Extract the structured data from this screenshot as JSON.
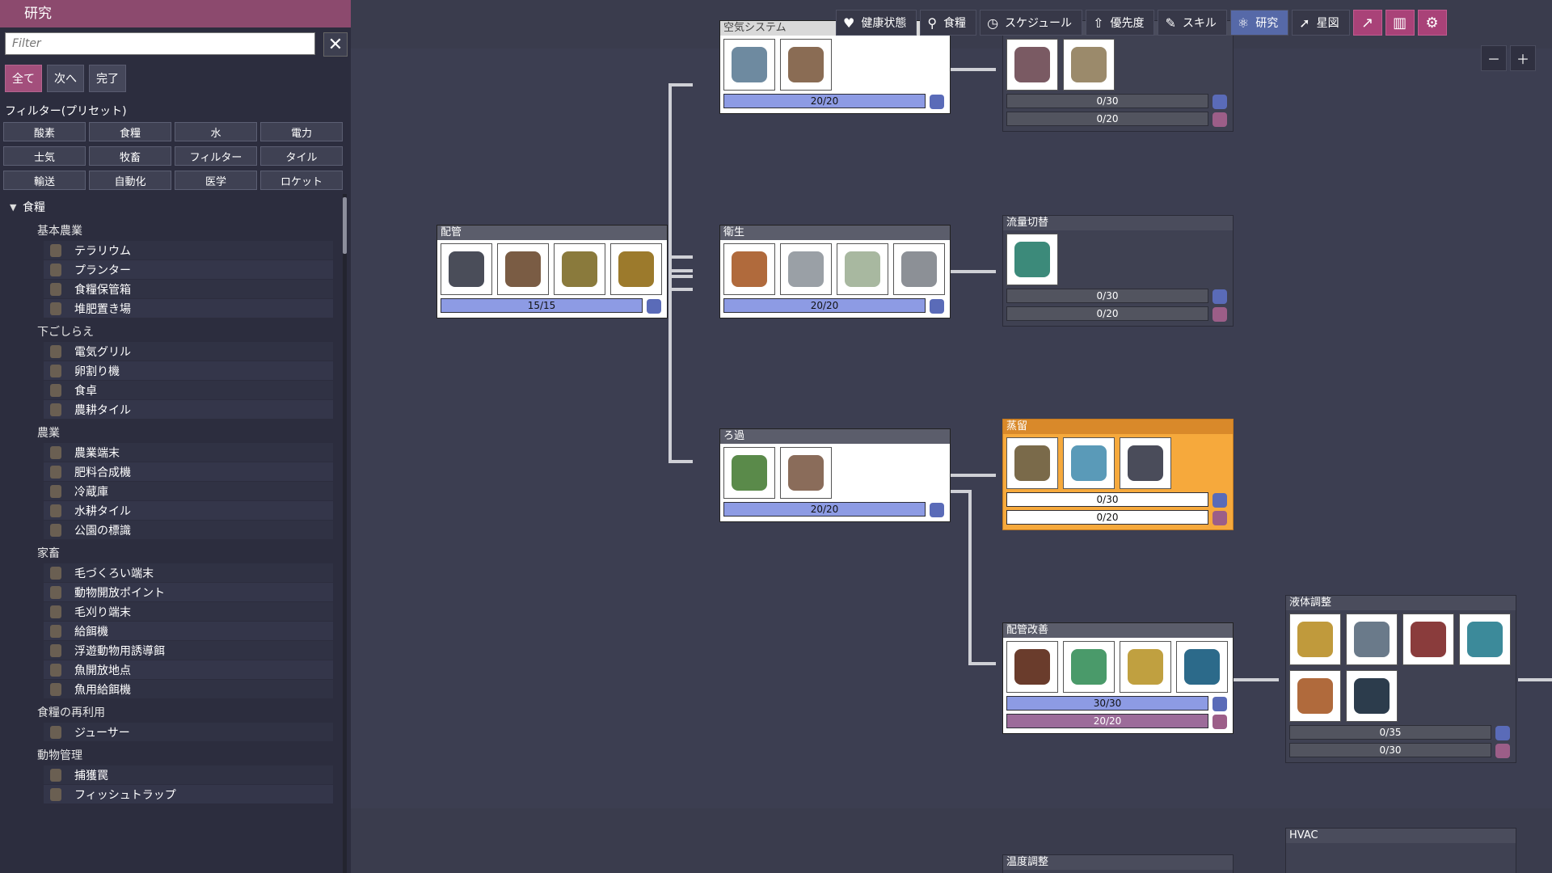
{
  "panel": {
    "title": "研究",
    "filter_placeholder": "Filter",
    "clear_icon": "close-icon",
    "modes": [
      "全て",
      "次へ",
      "完了"
    ],
    "preset_title": "フィルター(プリセット)",
    "presets": [
      "酸素",
      "食糧",
      "水",
      "電力",
      "士気",
      "牧畜",
      "フィルター",
      "タイル",
      "輸送",
      "自動化",
      "医学",
      "ロケット"
    ],
    "category": "食糧",
    "groups": [
      {
        "title": "基本農業",
        "items": [
          "テラリウム",
          "プランター",
          "食糧保管箱",
          "堆肥置き場"
        ]
      },
      {
        "title": "下ごしらえ",
        "items": [
          "電気グリル",
          "卵割り機",
          "食卓",
          "農耕タイル"
        ]
      },
      {
        "title": "農業",
        "items": [
          "農業端末",
          "肥料合成機",
          "冷蔵庫",
          "水耕タイル",
          "公園の標識"
        ]
      },
      {
        "title": "家畜",
        "items": [
          "毛づくろい端末",
          "動物開放ポイント",
          "毛刈り端末",
          "給餌機",
          "浮遊動物用誘導餌",
          "魚開放地点",
          "魚用給餌機"
        ]
      },
      {
        "title": "食糧の再利用",
        "items": [
          "ジューサー"
        ]
      },
      {
        "title": "動物管理",
        "items": [
          "捕獲罠",
          "フィッシュトラップ"
        ]
      }
    ]
  },
  "topbar": {
    "tabs": [
      {
        "label": "健康状態",
        "icon": "heart-icon"
      },
      {
        "label": "食糧",
        "icon": "fork-knife-icon"
      },
      {
        "label": "スケジュール",
        "icon": "clock-icon"
      },
      {
        "label": "優先度",
        "icon": "priority-icon"
      },
      {
        "label": "スキル",
        "icon": "wrench-icon"
      },
      {
        "label": "研究",
        "icon": "atom-icon"
      },
      {
        "label": "星図",
        "icon": "rocket-icon"
      }
    ],
    "extra_icons": [
      "chart-icon",
      "book-icon",
      "gear-icon"
    ],
    "zoom": [
      "zoom-out-icon",
      "zoom-in-icon"
    ]
  },
  "nodes": {
    "air": {
      "title": "空気システム",
      "bars": [
        "20/20"
      ]
    },
    "topright": {
      "title": "",
      "bars": [
        "0/30",
        "0/20"
      ]
    },
    "piping": {
      "title": "配管",
      "bars": [
        "15/15"
      ]
    },
    "sanitation": {
      "title": "衛生",
      "bars": [
        "20/20"
      ]
    },
    "flow": {
      "title": "流量切替",
      "bars": [
        "0/30",
        "0/20"
      ]
    },
    "filtration": {
      "title": "ろ過",
      "bars": [
        "20/20"
      ]
    },
    "distill": {
      "title": "蒸留",
      "bars": [
        "0/30",
        "0/20"
      ]
    },
    "improved": {
      "title": "配管改善",
      "bars": [
        "30/30",
        "20/20"
      ]
    },
    "liquid": {
      "title": "液体調整",
      "bars": [
        "0/35",
        "0/30"
      ]
    },
    "hvac": {
      "title": "HVAC"
    },
    "temp": {
      "title": "温度調整"
    }
  },
  "colors": {
    "accent": "#a34f7c",
    "research_blue": "#8d9be4",
    "highlight": "#f6a93c"
  }
}
